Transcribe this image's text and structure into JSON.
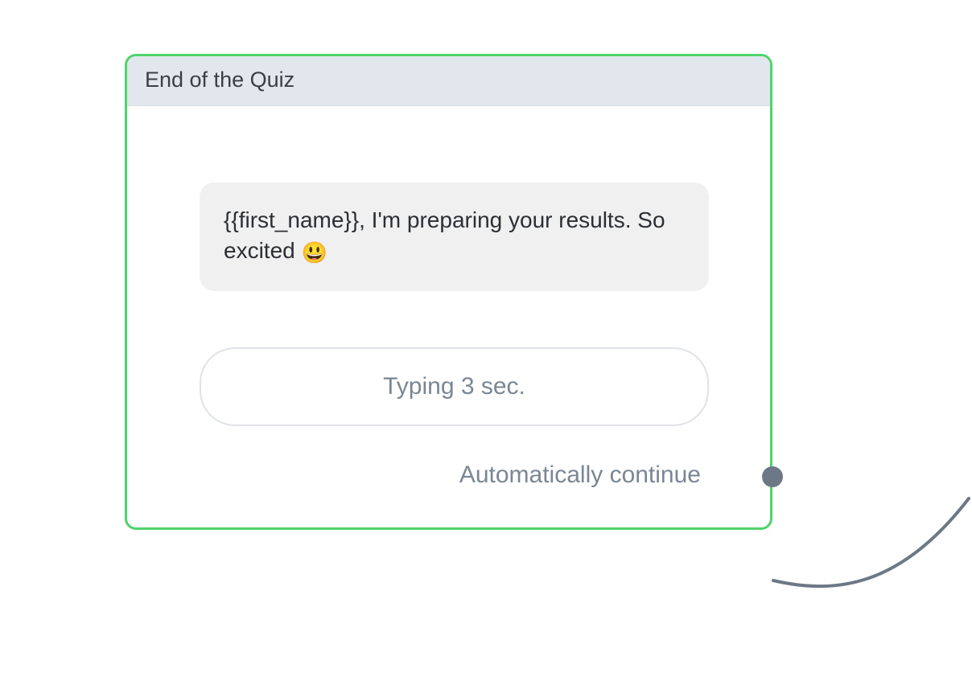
{
  "card": {
    "title": "End of the Quiz",
    "message_text": "{{first_name}}, I'm preparing your results. So excited",
    "message_emoji": "😃",
    "typing_label": "Typing 3 sec.",
    "auto_continue_label": "Automatically continue"
  }
}
